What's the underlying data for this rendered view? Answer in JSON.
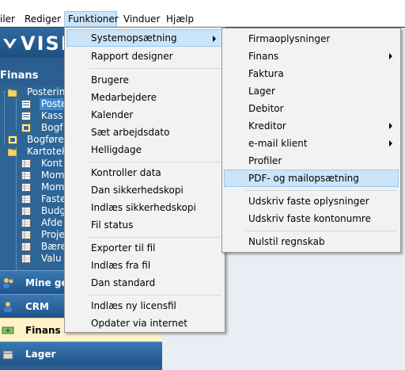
{
  "menubar": {
    "items": [
      {
        "label": "iler"
      },
      {
        "label": "Rediger"
      },
      {
        "label": "Funktioner"
      },
      {
        "label": "Vinduer"
      },
      {
        "label": "Hjælp"
      }
    ]
  },
  "brand": {
    "logo_text": "VISM"
  },
  "sidebar": {
    "title": "Finans",
    "tree": [
      {
        "label": "Posterin"
      },
      {
        "label": "Poste"
      },
      {
        "label": "Kass"
      },
      {
        "label": "Bogf"
      },
      {
        "label": "Bogføre"
      },
      {
        "label": "Kartotek"
      },
      {
        "label": "Kont"
      },
      {
        "label": "Mom"
      },
      {
        "label": "Mom"
      },
      {
        "label": "Faste"
      },
      {
        "label": "Budg"
      },
      {
        "label": "Afde"
      },
      {
        "label": "Proje"
      },
      {
        "label": "Bære"
      },
      {
        "label": "Valu"
      }
    ],
    "nav": [
      {
        "label": "Mine gen"
      },
      {
        "label": "CRM"
      },
      {
        "label": "Finans"
      },
      {
        "label": "Lager"
      }
    ]
  },
  "funktioner_menu": {
    "items": [
      {
        "label": "Systemopsætning"
      },
      {
        "label": "Rapport designer"
      },
      {
        "label": "Brugere"
      },
      {
        "label": "Medarbejdere"
      },
      {
        "label": "Kalender"
      },
      {
        "label": "Sæt arbejdsdato"
      },
      {
        "label": "Helligdage"
      },
      {
        "label": "Kontroller data"
      },
      {
        "label": "Dan sikkerhedskopi"
      },
      {
        "label": "Indlæs sikkerhedskopi"
      },
      {
        "label": "Fil status"
      },
      {
        "label": "Exporter til fil"
      },
      {
        "label": "Indlæs fra fil"
      },
      {
        "label": "Dan standard"
      },
      {
        "label": "Indlæs ny licensfil"
      },
      {
        "label": "Opdater via internet"
      }
    ]
  },
  "system_submenu": {
    "items": [
      {
        "label": "Firmaoplysninger"
      },
      {
        "label": "Finans"
      },
      {
        "label": "Faktura"
      },
      {
        "label": "Lager"
      },
      {
        "label": "Debitor"
      },
      {
        "label": "Kreditor"
      },
      {
        "label": "e-mail klient"
      },
      {
        "label": "Profiler"
      },
      {
        "label": "PDF- og mailopsætning"
      },
      {
        "label": "Udskriv faste oplysninger"
      },
      {
        "label": "Udskriv faste kontonumre"
      },
      {
        "label": "Nulstil regnskab"
      }
    ]
  },
  "colors": {
    "highlight": "#cce4f7",
    "highlight_border": "#99c9ef",
    "menu_bg": "#f2f2f2",
    "app_blue": "#2a5d8e",
    "active_nav": "#fff2c8"
  }
}
